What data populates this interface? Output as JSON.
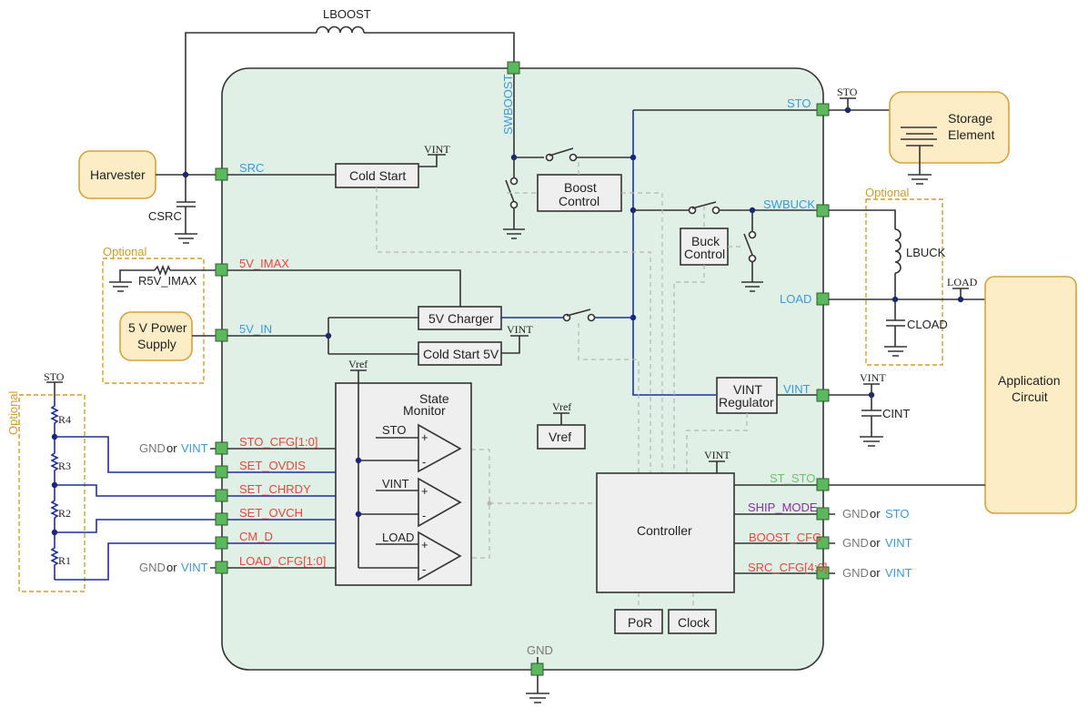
{
  "external": {
    "harvester": "Harvester",
    "storage_line1": "Storage",
    "storage_line2": "Element",
    "power_line1": "5 V Power",
    "power_line2": "Supply",
    "app_line1": "Application",
    "app_line2": "Circuit"
  },
  "components": {
    "lboost": "LBOOST",
    "csrc": "CSRC",
    "r5v_imax": "R5V_IMAX",
    "lbuck": "LBUCK",
    "cload": "CLOAD",
    "cint": "CINT",
    "r4": "R4",
    "r3": "R3",
    "r2": "R2",
    "r1": "R1"
  },
  "optional_label": "Optional",
  "blocks": {
    "cold_start": "Cold Start",
    "boost_control_1": "Boost",
    "boost_control_2": "Control",
    "buck_control_1": "Buck",
    "buck_control_2": "Control",
    "charger_5v": "5V Charger",
    "cold_start_5v": "Cold Start 5V",
    "vint_reg_1": "VINT",
    "vint_reg_2": "Regulator",
    "state_monitor_1": "State",
    "state_monitor_2": "Monitor",
    "vref": "Vref",
    "controller": "Controller",
    "por": "PoR",
    "clock": "Clock"
  },
  "comparators": [
    "STO",
    "VINT",
    "LOAD"
  ],
  "rails": {
    "vint": "VINT",
    "sto": "STO",
    "load": "LOAD",
    "vref": "Vref"
  },
  "pins": {
    "swboost": "SWBOOST",
    "src": "SRC",
    "v5_imax": "5V_IMAX",
    "v5_in": "5V_IN",
    "sto_cfg": "STO_CFG[1:0]",
    "set_ovdis": "SET_OVDIS",
    "set_chrdy": "SET_CHRDY",
    "set_ovch": "SET_OVCH",
    "cm_d": "CM_D",
    "load_cfg": "LOAD_CFG[1:0]",
    "sto": "STO",
    "swbuck": "SWBUCK",
    "load": "LOAD",
    "vint": "VINT",
    "st_sto": "ST_STO",
    "ship_mode": "SHIP_MODE",
    "boost_cfg": "BOOST_CFG",
    "src_cfg": "SRC_CFG[4:0]",
    "gnd": "GND"
  },
  "ties": {
    "gnd": "GND",
    "or": "or",
    "vint": "VINT",
    "sto": "STO"
  },
  "colors": {
    "chip_bg": "#e0f0e6",
    "pin": "#5cb85c",
    "external": "#fdedc7",
    "bus_blue": "#1f2f9a"
  }
}
